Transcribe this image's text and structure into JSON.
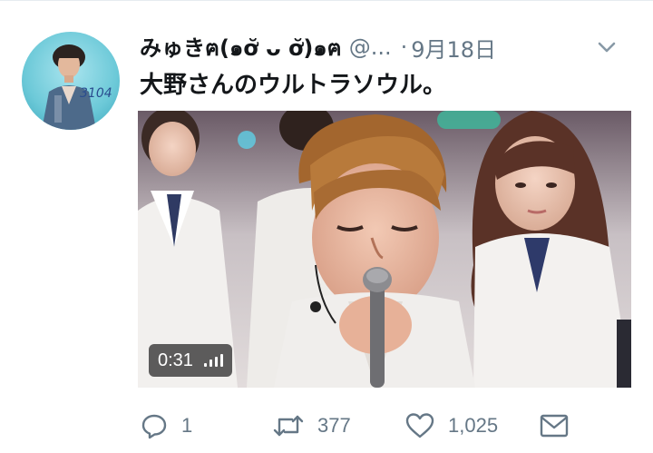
{
  "tweet": {
    "display_name": "みゅきฅ(๑ơ̆ ᴗ ơ̆)๑ฅ",
    "handle": "@...",
    "separator": "·",
    "date": "9月18日",
    "text": "大野さんのウルトラソウル。",
    "avatar_text": "3104"
  },
  "video": {
    "duration": "0:31"
  },
  "actions": {
    "reply_count": "1",
    "retweet_count": "377",
    "like_count": "1,025"
  },
  "colors": {
    "text_primary": "#14171a",
    "text_secondary": "#657786",
    "divider": "#e6ecf0"
  },
  "icons": [
    "chevron-down-icon",
    "volume-icon",
    "reply-icon",
    "retweet-icon",
    "heart-icon",
    "envelope-icon"
  ]
}
